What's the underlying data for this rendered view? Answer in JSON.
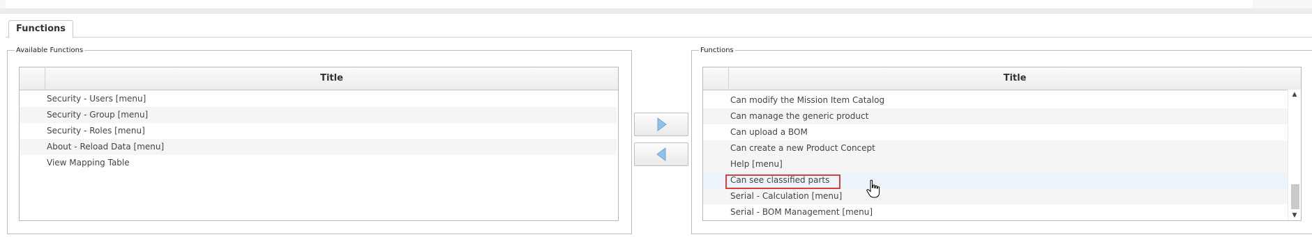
{
  "tab": {
    "label": "Functions"
  },
  "available": {
    "legend": "Available Functions",
    "column_title": "Title",
    "rows": [
      "Security - Users [menu]",
      "Security - Group [menu]",
      "Security - Roles [menu]",
      "About - Reload Data [menu]",
      "View Mapping Table"
    ]
  },
  "assigned": {
    "legend": "Functions",
    "column_title": "Title",
    "rows": [
      "Can modify the Mission Item Catalog",
      "Can manage the generic product",
      "Can upload a BOM",
      "Can create a new Product Concept",
      "Help [menu]",
      "Can see classified parts",
      "Serial - Calculation [menu]",
      "Serial - BOM Management [menu]"
    ],
    "highlighted_row": "Can see classified parts"
  },
  "buttons": {
    "add": {
      "icon": "arrow-right-icon"
    },
    "remove": {
      "icon": "arrow-left-icon"
    }
  },
  "colors": {
    "highlight_border": "#d9403a",
    "arrow_blue": "#8fc1ea"
  }
}
